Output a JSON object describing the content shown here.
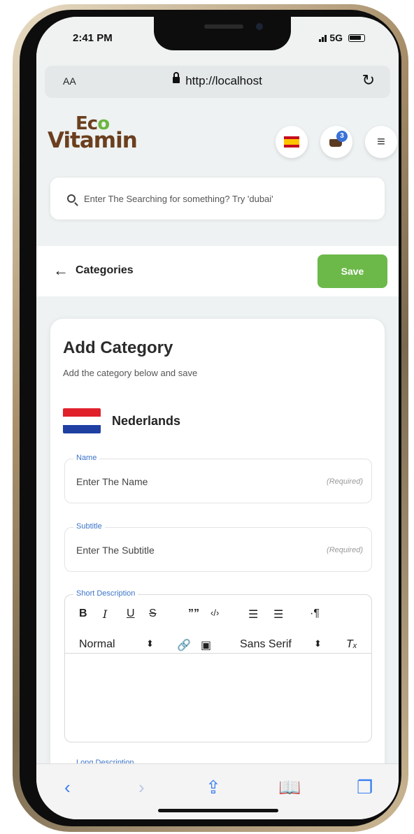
{
  "status": {
    "time": "2:41 PM",
    "network": "5G"
  },
  "browser": {
    "aa": "AA",
    "url": "http://localhost"
  },
  "brand": {
    "line1_a": "Ec",
    "line1_b": "o",
    "line2": "Vitamin"
  },
  "cart": {
    "count": "3"
  },
  "search": {
    "placeholder": "Enter The Searching for something? Try 'dubai'"
  },
  "pagebar": {
    "back_label": "Categories",
    "save_label": "Save"
  },
  "card": {
    "title": "Add Category",
    "subtitle": "Add the category below and save",
    "language": "Nederlands",
    "fields": {
      "name": {
        "legend": "Name",
        "placeholder": "Enter The Name",
        "hint": "(Required)"
      },
      "subtitle": {
        "legend": "Subtitle",
        "placeholder": "Enter The Subtitle",
        "hint": "(Required)"
      },
      "short_description": {
        "legend": "Short Description"
      },
      "long_description": {
        "legend": "Long Description"
      }
    },
    "toolbar": {
      "bold": "B",
      "italic": "I",
      "underline": "U",
      "strike": "S",
      "quote": "””",
      "code": "‹/›",
      "ordered_list": "☰",
      "bullet_list": "☰",
      "rtl": "·¶",
      "size_select": "Normal",
      "font_select": "Sans Serif",
      "clear": "Tₓ"
    }
  },
  "colors": {
    "accent_green": "#6cb94a",
    "label_blue": "#3c74c8",
    "brand_brown": "#6b3f1e",
    "ios_blue": "#3a7ef0"
  }
}
